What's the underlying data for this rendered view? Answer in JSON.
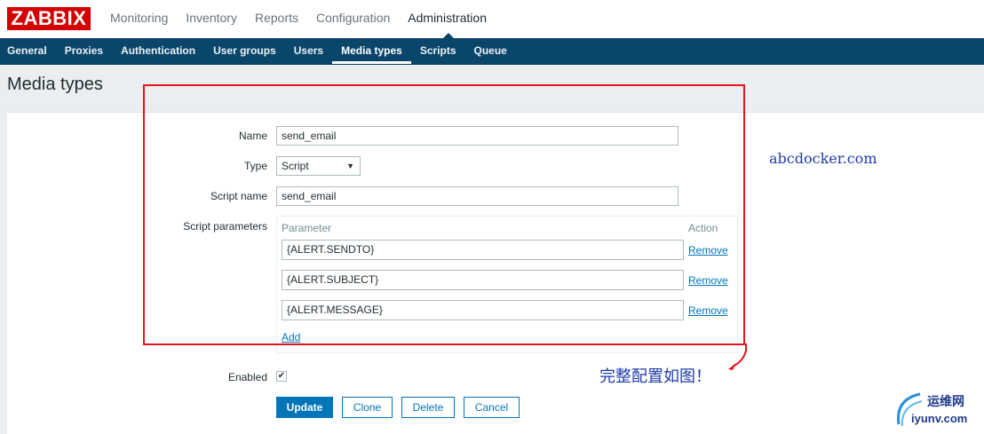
{
  "logo": "ZABBIX",
  "main_nav": [
    "Monitoring",
    "Inventory",
    "Reports",
    "Configuration",
    "Administration"
  ],
  "sub_nav": [
    "General",
    "Proxies",
    "Authentication",
    "User groups",
    "Users",
    "Media types",
    "Scripts",
    "Queue"
  ],
  "page_title": "Media types",
  "form": {
    "name_label": "Name",
    "name_value": "send_email",
    "type_label": "Type",
    "type_value": "Script",
    "script_name_label": "Script name",
    "script_name_value": "send_email",
    "script_params_label": "Script parameters",
    "param_col_header": "Parameter",
    "action_col_header": "Action",
    "params": [
      "{ALERT.SENDTO}",
      "{ALERT.SUBJECT}",
      "{ALERT.MESSAGE}"
    ],
    "remove_label": "Remove",
    "add_label": "Add",
    "enabled_label": "Enabled",
    "enabled_checked": true,
    "checkmark": "✔"
  },
  "buttons": {
    "update": "Update",
    "clone": "Clone",
    "delete": "Delete",
    "cancel": "Cancel"
  },
  "annotations": {
    "url": "abcdocker.com",
    "note": "完整配置如图！"
  },
  "watermark": {
    "line1": "运维网",
    "line2": "iyunv.com"
  },
  "colors": {
    "brand_red": "#d40000",
    "nav_blue": "#0a466a",
    "link_blue": "#0275b8",
    "annotation_red": "#e8141c"
  }
}
